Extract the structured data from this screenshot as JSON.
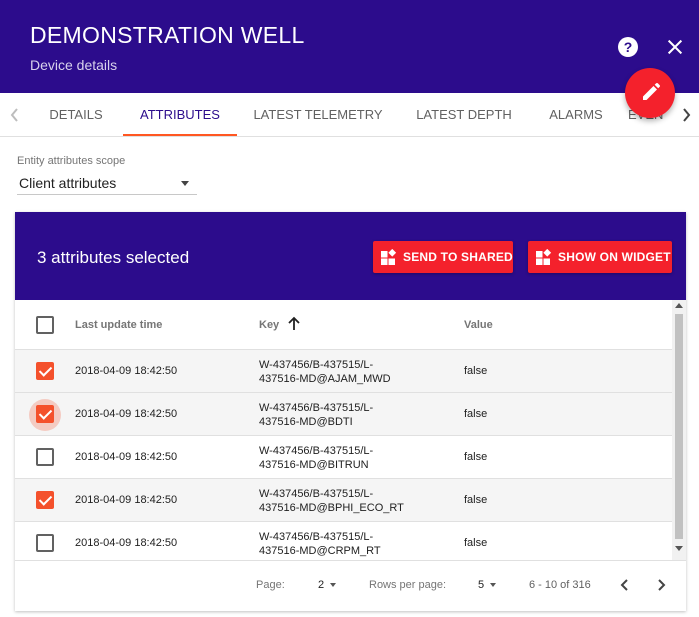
{
  "header": {
    "title": "DEMONSTRATION WELL",
    "subtitle": "Device details",
    "help_icon": "help-icon",
    "close_icon": "close-icon",
    "edit_icon": "pencil-icon",
    "background": "#2c0c8c",
    "accent": "#f4212c"
  },
  "tabs": [
    {
      "label": "DETAILS",
      "active": false
    },
    {
      "label": "ATTRIBUTES",
      "active": true
    },
    {
      "label": "LATEST TELEMETRY",
      "active": false
    },
    {
      "label": "LATEST DEPTH",
      "active": false
    },
    {
      "label": "ALARMS",
      "active": false
    },
    {
      "label": "EVEN",
      "active": false
    }
  ],
  "scope": {
    "label": "Entity attributes scope",
    "value": "Client attributes"
  },
  "toolbar": {
    "selected_text": "3 attributes selected",
    "send_shared_label": "SEND TO SHARED",
    "show_widget_label": "SHOW ON WIDGET"
  },
  "table": {
    "columns": {
      "time": "Last update time",
      "key": "Key",
      "value": "Value"
    },
    "rows": [
      {
        "checked": true,
        "time": "2018-04-09 18:42:50",
        "key_line1": "W-437456/B-437515/L-",
        "key_line2": "437516-MD@AJAM_MWD",
        "value": "false"
      },
      {
        "checked": true,
        "time": "2018-04-09 18:42:50",
        "key_line1": "W-437456/B-437515/L-",
        "key_line2": "437516-MD@BDTI",
        "value": "false"
      },
      {
        "checked": false,
        "time": "2018-04-09 18:42:50",
        "key_line1": "W-437456/B-437515/L-",
        "key_line2": "437516-MD@BITRUN",
        "value": "false"
      },
      {
        "checked": true,
        "time": "2018-04-09 18:42:50",
        "key_line1": "W-437456/B-437515/L-",
        "key_line2": "437516-MD@BPHI_ECO_RT",
        "value": "false"
      },
      {
        "checked": false,
        "time": "2018-04-09 18:42:50",
        "key_line1": "W-437456/B-437515/L-",
        "key_line2": "437516-MD@CRPM_RT",
        "value": "false"
      }
    ]
  },
  "pagination": {
    "page_label": "Page:",
    "page_value": "2",
    "rows_label": "Rows per page:",
    "rows_value": "5",
    "range": "6 - 10 of 316"
  }
}
